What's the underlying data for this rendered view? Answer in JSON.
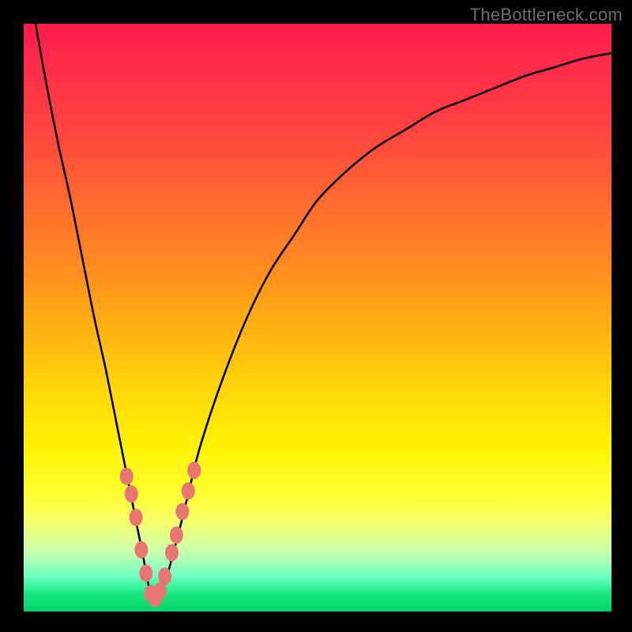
{
  "watermark": "TheBottleneck.com",
  "colors": {
    "curve_stroke": "#000000",
    "marker_fill": "#e77672",
    "marker_stroke": "#c95c58",
    "background_frame": "#000000"
  },
  "chart_data": {
    "type": "line",
    "title": "",
    "xlabel": "",
    "ylabel": "",
    "xlim": [
      0,
      100
    ],
    "ylim": [
      0,
      100
    ],
    "grid": false,
    "legend": false,
    "series": [
      {
        "name": "bottleneck-curve",
        "note": "V-shaped curve; y is approx. bottleneck percentage (100=max, 0=no bottleneck). Minimum near x≈22.",
        "x": [
          2,
          4,
          6,
          8,
          10,
          12,
          14,
          16,
          18,
          20,
          22,
          24,
          26,
          28,
          30,
          34,
          38,
          42,
          46,
          50,
          55,
          60,
          65,
          70,
          75,
          80,
          85,
          90,
          95,
          100
        ],
        "y": [
          100,
          89,
          79,
          70,
          60,
          50,
          41,
          31,
          21,
          11,
          2,
          5,
          12,
          20,
          28,
          40,
          50,
          58,
          64,
          70,
          75,
          79,
          82,
          85,
          87,
          89,
          91,
          92.5,
          94,
          95
        ]
      }
    ],
    "markers": {
      "name": "highlighted-points",
      "x": [
        17.5,
        18.3,
        19.1,
        20.0,
        20.8,
        21.6,
        22.4,
        23.2,
        24.0,
        25.2,
        26.0,
        27.0,
        28.0,
        29.0
      ],
      "y": [
        23,
        20,
        16,
        10.5,
        6.5,
        3,
        2.2,
        3.5,
        6,
        10,
        13,
        17,
        20.5,
        24
      ]
    }
  }
}
